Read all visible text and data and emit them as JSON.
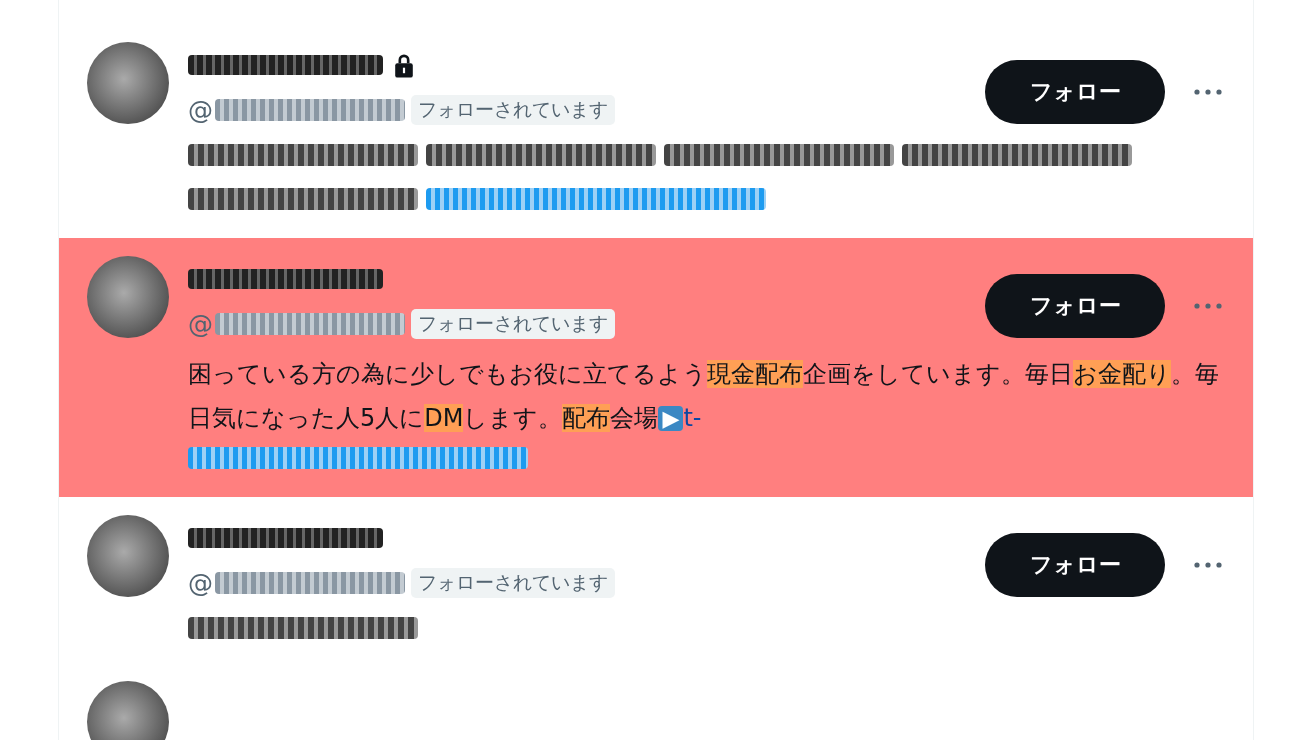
{
  "users": [
    {
      "highlighted": false,
      "locked": true,
      "handle_prefix": "@",
      "follows_you": "フォローされています",
      "follow_button": "フォロー",
      "bio": [
        {
          "kind": "redacted"
        },
        {
          "kind": "redacted"
        },
        {
          "kind": "redacted"
        },
        {
          "kind": "redacted"
        },
        {
          "kind": "redacted"
        },
        {
          "kind": "redacted_link"
        }
      ]
    },
    {
      "highlighted": true,
      "locked": false,
      "handle_prefix": "@",
      "follows_you": "フォローされています",
      "follow_button": "フォロー",
      "bio": [
        {
          "kind": "text",
          "text": "困っている方の為に少しでもお役に立てるよう"
        },
        {
          "kind": "mark",
          "text": "現金配布"
        },
        {
          "kind": "text",
          "text": "企画をしています。毎日"
        },
        {
          "kind": "mark",
          "text": "お金配り"
        },
        {
          "kind": "text",
          "text": "。毎日気になった人5人に"
        },
        {
          "kind": "mark",
          "text": "DM"
        },
        {
          "kind": "text",
          "text": "します。"
        },
        {
          "kind": "mark",
          "text": "配布"
        },
        {
          "kind": "text",
          "text": "会場"
        },
        {
          "kind": "emoji",
          "text": "▶"
        },
        {
          "kind": "link",
          "text": "t-"
        },
        {
          "kind": "redacted_link"
        }
      ]
    },
    {
      "highlighted": false,
      "locked": false,
      "handle_prefix": "@",
      "follows_you": "フォローされています",
      "follow_button": "フォロー",
      "bio": [
        {
          "kind": "redacted"
        }
      ]
    }
  ],
  "cut_off_row": true
}
